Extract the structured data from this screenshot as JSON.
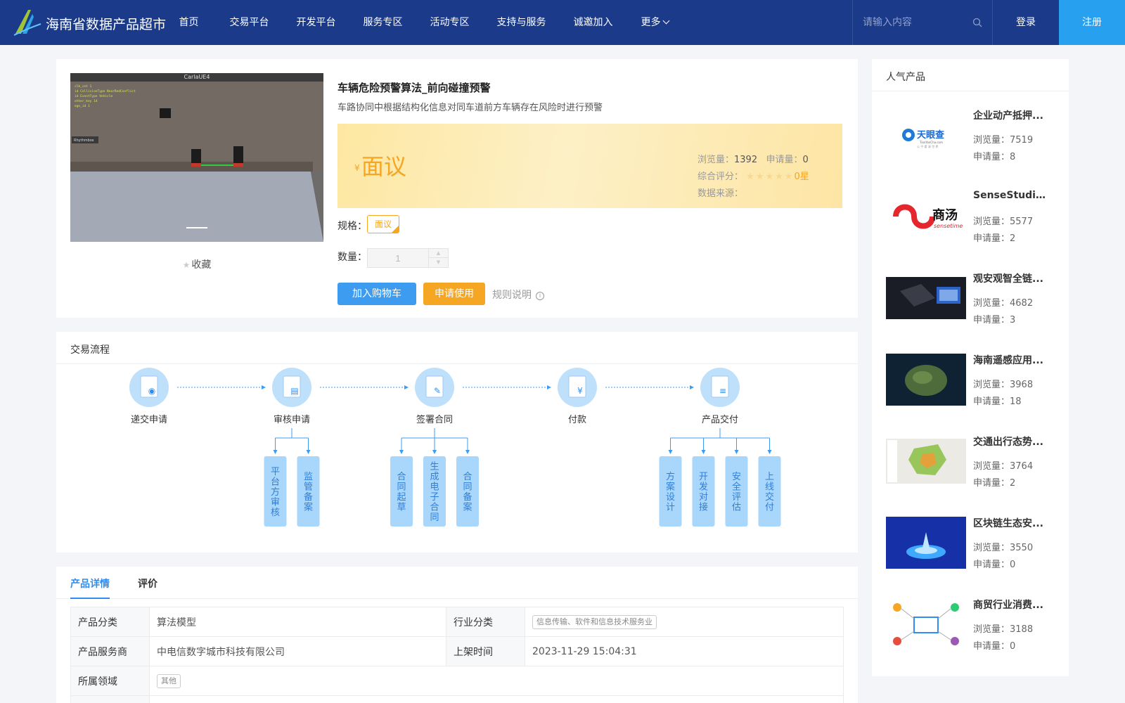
{
  "header": {
    "site_title": "海南省数据产品超市",
    "nav": [
      "首页",
      "交易平台",
      "开发平台",
      "服务专区",
      "活动专区",
      "支持与服务",
      "诚邀加入",
      "更多"
    ],
    "search_placeholder": "请输入内容",
    "login": "登录",
    "register": "注册"
  },
  "product": {
    "title": "车辆危险预警算法_前向碰撞预警",
    "subtitle": "车路协同中根据结构化信息对同车道前方车辆存在风险时进行预警",
    "image_window_title": "CarlaUE4",
    "image_overlay_label": "Rhythmbox",
    "favorite": "收藏",
    "currency": "¥",
    "price": "面议",
    "views_label": "浏览量：",
    "views": "1392",
    "applies_label": "申请量：",
    "applies": "0",
    "rating_label": "综合评分：",
    "rating_text": "0星",
    "rating_value": 0,
    "source_label": "数据来源：",
    "spec_label": "规格：",
    "spec_value": "面议",
    "qty_label": "数量：",
    "qty_value": "1",
    "btn_cart": "加入购物车",
    "btn_apply": "申请使用",
    "rules": "规则说明"
  },
  "flow": {
    "title": "交易流程",
    "steps": [
      "递交申请",
      "审核申请",
      "签署合同",
      "付款",
      "产品交付"
    ],
    "sub_steps": {
      "审核申请": [
        "平台方审核",
        "监管备案"
      ],
      "签署合同": [
        "合同起草",
        "生成电子合同",
        "合同备案"
      ],
      "产品交付": [
        "方案设计",
        "开发对接",
        "安全评估",
        "上线交付"
      ]
    }
  },
  "details": {
    "tabs": [
      "产品详情",
      "评价"
    ],
    "rows": [
      {
        "k1": "产品分类",
        "v1": "算法模型",
        "k2": "行业分类",
        "v2": "信息传输、软件和信息技术服务业"
      },
      {
        "k1": "产品服务商",
        "v1": "中电信数字城市科技有限公司",
        "k2": "上架时间",
        "v2": "2023-11-29 15:04:31"
      },
      {
        "k1": "所属领域",
        "v1": "其他"
      }
    ]
  },
  "sidebar": {
    "title": "人气产品",
    "views_prefix": "浏览量：",
    "applies_prefix": "申请量：",
    "items": [
      {
        "name": "企业动产抵押...",
        "views": "7519",
        "applies": "8",
        "thumb": "tianyancha-logo"
      },
      {
        "name": "SenseStudio...",
        "views": "5577",
        "applies": "2",
        "thumb": "sensetime-logo"
      },
      {
        "name": "观安观智全链...",
        "views": "4682",
        "applies": "3",
        "thumb": "device-photo"
      },
      {
        "name": "海南遥感应用...",
        "views": "3968",
        "applies": "18",
        "thumb": "satellite-map"
      },
      {
        "name": "交通出行态势...",
        "views": "3764",
        "applies": "2",
        "thumb": "region-map"
      },
      {
        "name": "区块链生态安...",
        "views": "3550",
        "applies": "0",
        "thumb": "blockchain-art"
      },
      {
        "name": "商贸行业消费...",
        "views": "3188",
        "applies": "0",
        "thumb": "network-diagram"
      }
    ],
    "thumb_text": {
      "tianyancha_cn": "天眼查",
      "tianyancha_en": "TianYanCha.com",
      "tianyancha_slogan": "公 平 看 清 世 界",
      "sensetime_cn": "商汤",
      "sensetime_en": "sensetime"
    }
  },
  "colors": {
    "header_bg": "#1b3a8a",
    "primary": "#3d9cf0",
    "accent": "#f5a623",
    "register_bg": "#28a0f0"
  }
}
